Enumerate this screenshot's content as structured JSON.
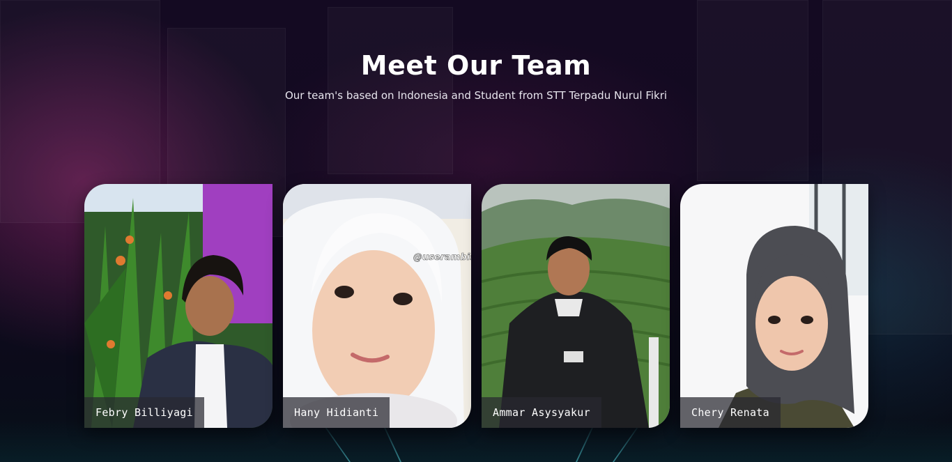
{
  "header": {
    "title": "Meet Our Team",
    "subtitle": "Our team's based on Indonesia and Student from STT Terpadu Nurul Fikri"
  },
  "team": [
    {
      "name": "Febry Billiyagi",
      "photo_icon": "person-photo"
    },
    {
      "name": "Hany Hidianti",
      "photo_icon": "person-photo",
      "watermark": "@userambis"
    },
    {
      "name": "Ammar Asysyakur",
      "photo_icon": "person-photo"
    },
    {
      "name": "Chery Renata",
      "photo_icon": "person-photo"
    }
  ],
  "colors": {
    "background": "#0c0717",
    "name_tag_bg": "#28283099",
    "title": "#ffffff"
  }
}
